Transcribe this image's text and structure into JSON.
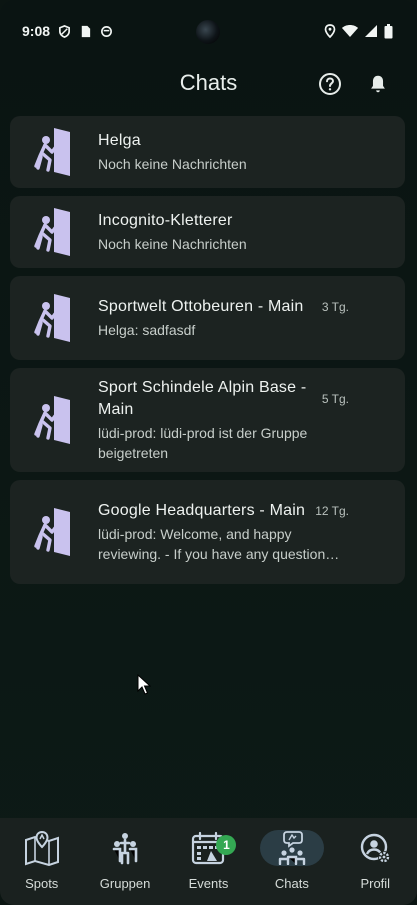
{
  "status_bar": {
    "time": "9:08",
    "left_icons": [
      "shield-icon",
      "sim-card-icon",
      "sync-icon"
    ],
    "right_icons": [
      "location-icon",
      "wifi-icon",
      "signal-icon",
      "battery-icon"
    ]
  },
  "header": {
    "title": "Chats",
    "help_icon": "help-circle-icon",
    "bell_icon": "bell-icon"
  },
  "chats": [
    {
      "name": "Helga",
      "preview": "Noch keine Nachrichten",
      "time": ""
    },
    {
      "name": "Incognito-Kletterer",
      "preview": "Noch keine Nachrichten",
      "time": ""
    },
    {
      "name": "Sportwelt Ottobeuren - Main",
      "preview": "Helga: sadfasdf",
      "time": "3 Tg."
    },
    {
      "name": "Sport Schindele Alpin Base - Main",
      "preview": "lüdi-prod: lüdi-prod ist der Gruppe beigetreten",
      "time": "5 Tg."
    },
    {
      "name": "Google Headquarters - Main",
      "preview": "lüdi-prod: Welcome, and happy reviewing. - If you have any question…",
      "time": "12 Tg."
    }
  ],
  "bottom_nav": [
    {
      "label": "Spots",
      "icon": "map-pin-icon",
      "active": false
    },
    {
      "label": "Gruppen",
      "icon": "group-icon",
      "active": false
    },
    {
      "label": "Events",
      "icon": "calendar-icon",
      "active": false,
      "badge": "1"
    },
    {
      "label": "Chats",
      "icon": "chat-group-icon",
      "active": true
    },
    {
      "label": "Profil",
      "icon": "profile-gear-icon",
      "active": false
    }
  ],
  "colors": {
    "background": "#0b1512",
    "card": "#1c2321",
    "accent_avatar": "#c9c2ee",
    "badge": "#34a853",
    "active_nav": "#2b3d45"
  }
}
